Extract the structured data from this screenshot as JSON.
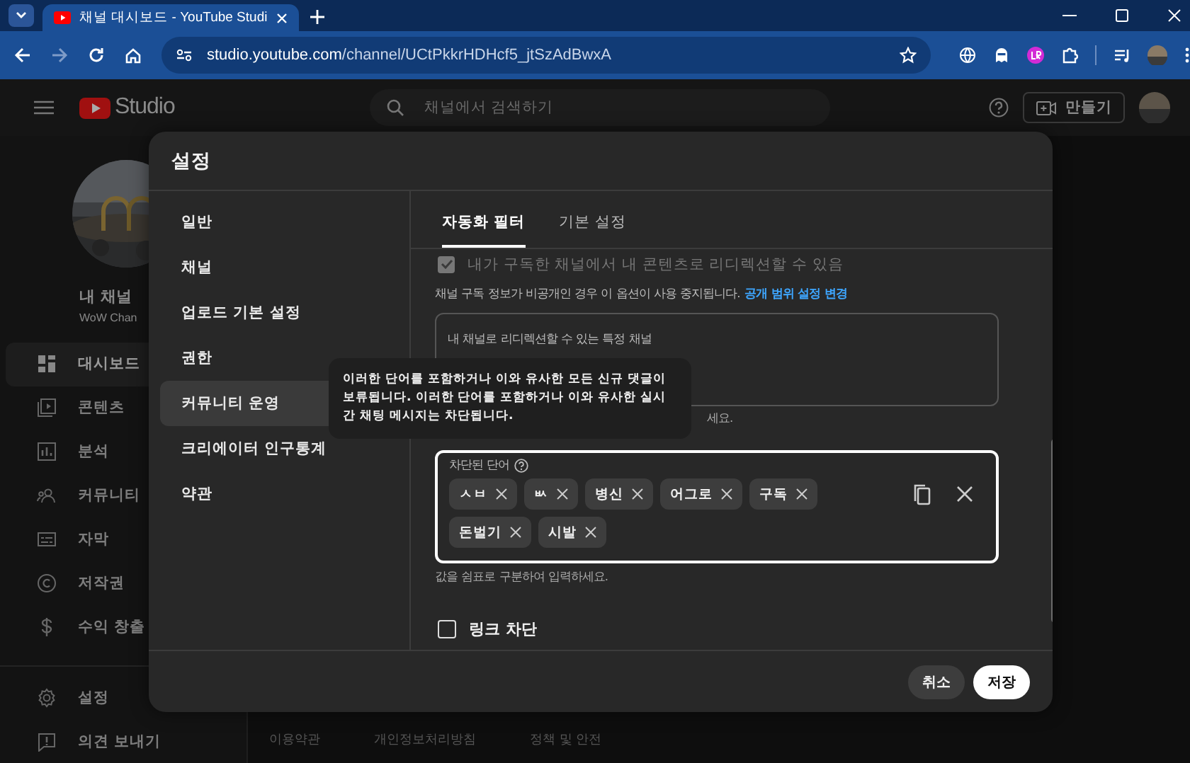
{
  "browser": {
    "tabs": [
      {
        "title": "채널 대시보드 - YouTube Studi",
        "selected": true
      }
    ],
    "address": {
      "host": "studio.youtube.com",
      "path": "/channel/UCtPkkrHDHcf5_jtSzAdBwxA"
    }
  },
  "header": {
    "logo": "Studio",
    "search_placeholder": "채널에서 검색하기",
    "create_button": "만들기"
  },
  "sidebar": {
    "channel_name": "내 채널",
    "channel_handle": "WoW Chan",
    "items": [
      {
        "label": "대시보드",
        "kind": "dashboard",
        "selected": true
      },
      {
        "label": "콘텐츠",
        "kind": "content",
        "selected": false
      },
      {
        "label": "분석",
        "kind": "analytics",
        "selected": false
      },
      {
        "label": "커뮤니티",
        "kind": "community",
        "selected": false
      },
      {
        "label": "자막",
        "kind": "subtitles",
        "selected": false
      },
      {
        "label": "저작권",
        "kind": "copyright",
        "selected": false
      },
      {
        "label": "수익 창출",
        "kind": "earn",
        "selected": false
      }
    ],
    "bottom_items": [
      {
        "label": "설정",
        "kind": "settings"
      },
      {
        "label": "의견 보내기",
        "kind": "feedback"
      }
    ]
  },
  "footer_links": [
    "이용약관",
    "개인정보처리방침",
    "정책 및 안전"
  ],
  "settings": {
    "title": "설정",
    "nav": [
      {
        "label": "일반",
        "selected": false
      },
      {
        "label": "채널",
        "selected": false
      },
      {
        "label": "업로드 기본 설정",
        "selected": false
      },
      {
        "label": "권한",
        "selected": false
      },
      {
        "label": "커뮤니티 운영",
        "selected": true
      },
      {
        "label": "크리에이터 인구통계",
        "selected": false
      },
      {
        "label": "약관",
        "selected": false
      }
    ],
    "tabs": [
      {
        "label": "자동화 필터",
        "selected": true
      },
      {
        "label": "기본 설정",
        "selected": false
      }
    ],
    "redirect_option": {
      "label": "내가 구독한 채널에서 내 콘텐츠로 리디렉션할 수 있음",
      "checked": true,
      "disabled": true
    },
    "privacy_note": {
      "text": "채널 구독 정보가 비공개인 경우 이 옵션이 사용 중지됩니다.",
      "link": "공개 범위 설정 변경"
    },
    "channels_field": {
      "label": "내 채널로 리디렉션할 수 있는 특정 채널"
    },
    "channels_hint": "세요.",
    "blocked_words": {
      "label": "차단된 단어",
      "words": [
        "ㅅㅂ",
        "ㅄ",
        "병신",
        "어그로",
        "구독",
        "돈벌기",
        "시발"
      ],
      "hint": "값을 쉼표로 구분하여 입력하세요."
    },
    "block_links": {
      "label": "링크 차단",
      "checked": false
    },
    "buttons": [
      {
        "label": "취소",
        "kind": "secondary"
      },
      {
        "label": "저장",
        "kind": "primary"
      }
    ],
    "tooltip": "이러한 단어를 포함하거나 이와 유사한 모든 신규 댓글이 보류됩니다. 이러한 단어를 포함하거나 이와 유사한 실시간 채팅 메시지는 차단됩니다."
  }
}
